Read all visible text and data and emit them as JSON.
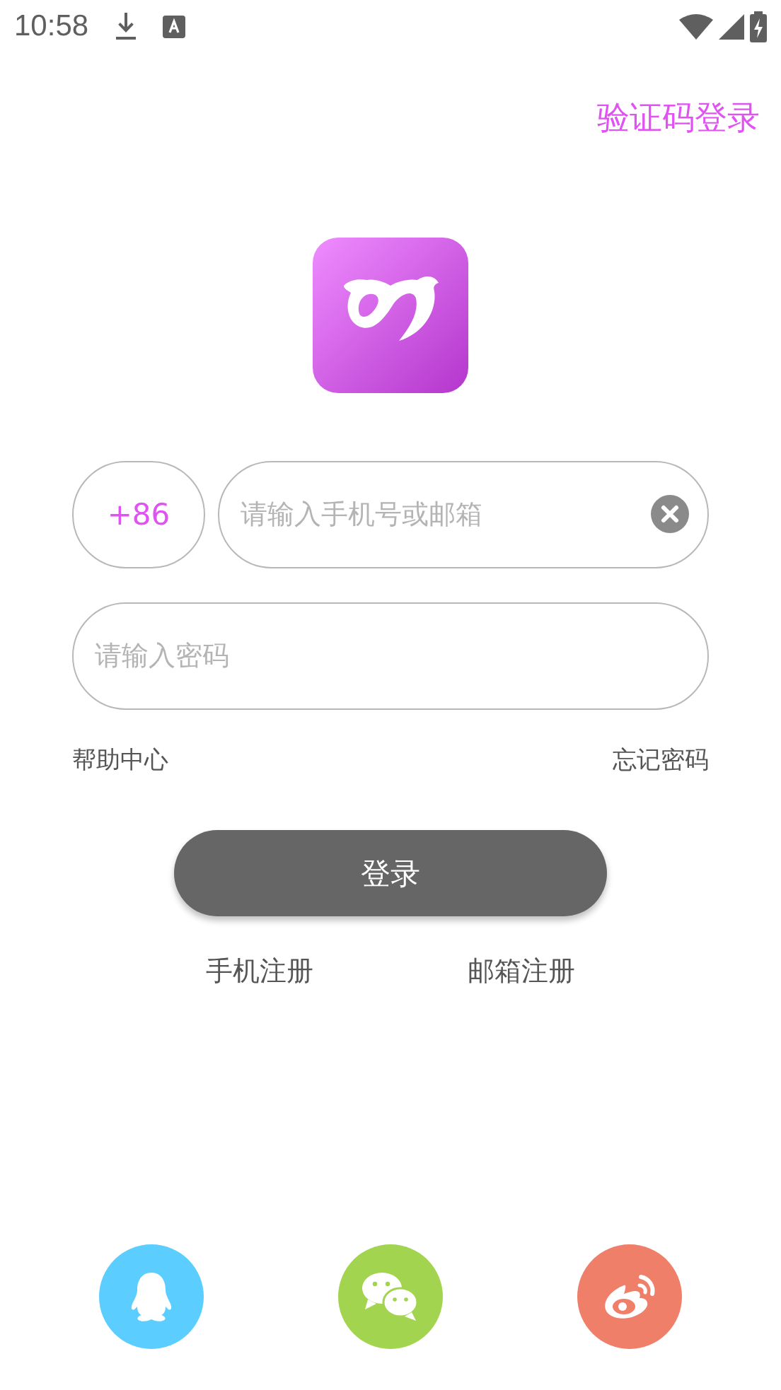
{
  "status_bar": {
    "time": "10:58"
  },
  "top_link": "验证码登录",
  "phone_field": {
    "country_code": "+86",
    "placeholder": "请输入手机号或邮箱"
  },
  "password_field": {
    "placeholder": "请输入密码"
  },
  "help_link": "帮助中心",
  "forgot_link": "忘记密码",
  "login_button": "登录",
  "register_links": [
    "手机注册",
    "邮箱注册"
  ],
  "social_logins": [
    {
      "kind": "penguin",
      "color": "#5ccdff"
    },
    {
      "kind": "chat",
      "color": "#a2d44f"
    },
    {
      "kind": "weibo",
      "color": "#f07f69"
    }
  ]
}
